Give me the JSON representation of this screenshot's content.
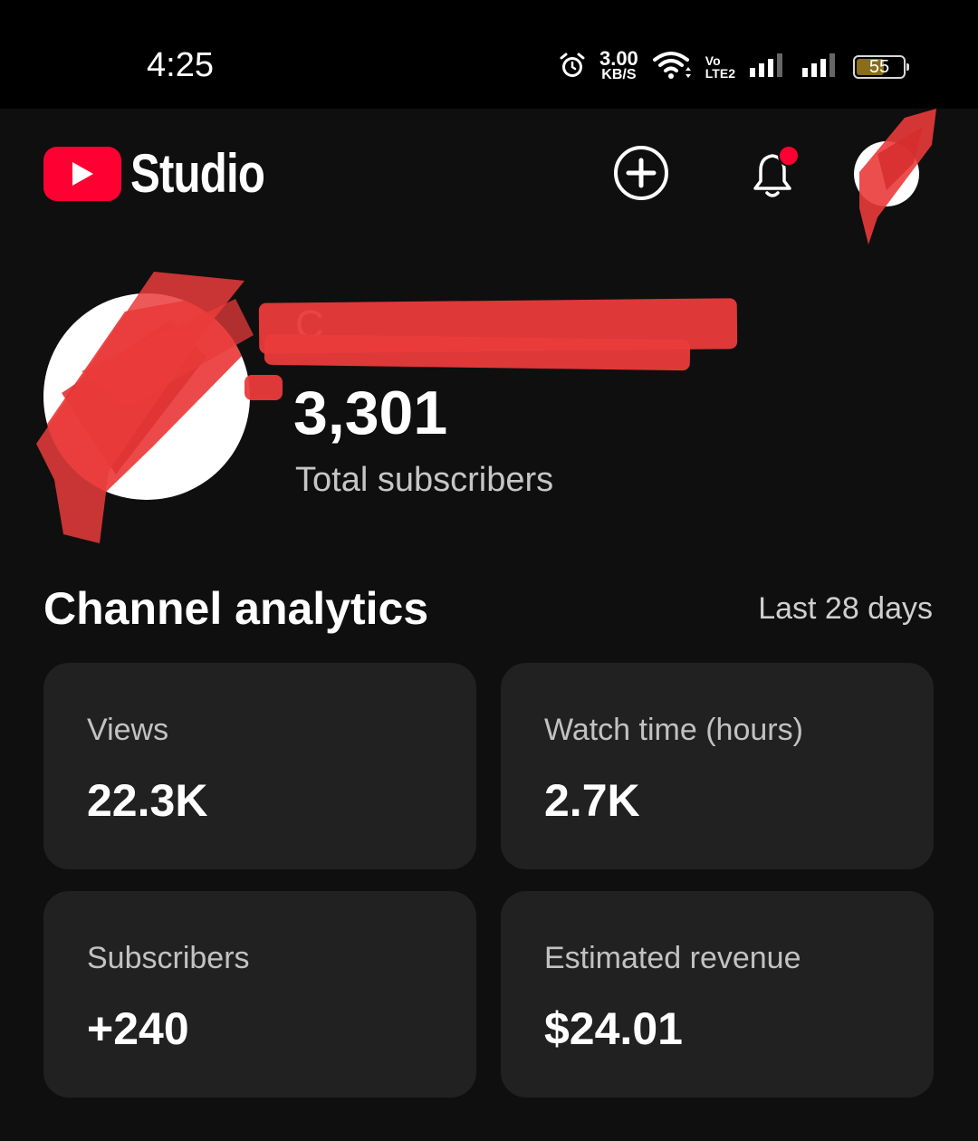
{
  "status_bar": {
    "time": "4:25",
    "net_speed_value": "3.00",
    "net_speed_unit": "KB/S",
    "volte_top": "Vo",
    "volte_bottom": "LTE2",
    "battery_level": "55"
  },
  "header": {
    "app_name": "Studio",
    "icons": [
      "youtube-logo-icon",
      "create-icon",
      "notifications-icon",
      "account-avatar"
    ],
    "notification_dot": true,
    "accent_color": "#ff0033"
  },
  "channel": {
    "name_fragment": "C",
    "subscriber_count": "3,301",
    "subscriber_label": "Total subscribers"
  },
  "analytics": {
    "title": "Channel analytics",
    "period": "Last 28 days",
    "cards": [
      {
        "label": "Views",
        "value": "22.3K"
      },
      {
        "label": "Watch time (hours)",
        "value": "2.7K"
      },
      {
        "label": "Subscribers",
        "value": "+240"
      },
      {
        "label": "Estimated revenue",
        "value": "$24.01"
      }
    ]
  },
  "colors": {
    "background": "#0f0f0f",
    "card": "#212121",
    "status_bar": "#000000",
    "redaction": "#ea3b3b"
  }
}
